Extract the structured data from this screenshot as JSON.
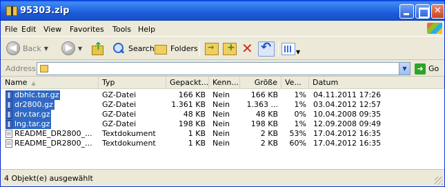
{
  "window": {
    "title": "95303.zip"
  },
  "menu": {
    "items": [
      "File",
      "Edit",
      "View",
      "Favorites",
      "Tools",
      "Help"
    ]
  },
  "toolbar": {
    "back_label": "Back",
    "search_label": "Search",
    "folders_label": "Folders"
  },
  "address": {
    "label": "Address",
    "value": "",
    "go_label": "Go"
  },
  "columns": [
    "Name",
    "Typ",
    "Gepackt...",
    "Kenn...",
    "Größe",
    "Ve...",
    "Datum"
  ],
  "files": [
    {
      "name": "dbhlc.tar.gz",
      "type": "GZ-Datei",
      "packed": "166 KB",
      "protected": "Nein",
      "size": "166 KB",
      "ratio": "1%",
      "date": "04.11.2011 17:26",
      "selected": true,
      "icon": "gz-archive-icon"
    },
    {
      "name": "dr2800.gz",
      "type": "GZ-Datei",
      "packed": "1.361 KB",
      "protected": "Nein",
      "size": "1.363 ...",
      "ratio": "1%",
      "date": "03.04.2012 12:57",
      "selected": true,
      "icon": "gz-archive-icon"
    },
    {
      "name": "drv.tar.gz",
      "type": "GZ-Datei",
      "packed": "48 KB",
      "protected": "Nein",
      "size": "48 KB",
      "ratio": "0%",
      "date": "10.04.2008 09:35",
      "selected": true,
      "icon": "gz-archive-icon"
    },
    {
      "name": "lng.tar.gz",
      "type": "GZ-Datei",
      "packed": "198 KB",
      "protected": "Nein",
      "size": "198 KB",
      "ratio": "1%",
      "date": "12.09.2008 09:49",
      "selected": true,
      "icon": "gz-archive-icon"
    },
    {
      "name": "README_DR2800_...",
      "type": "Textdokument",
      "packed": "1 KB",
      "protected": "Nein",
      "size": "2 KB",
      "ratio": "53%",
      "date": "17.04.2012 16:35",
      "selected": false,
      "icon": "text-document-icon"
    },
    {
      "name": "README_DR2800_...",
      "type": "Textdokument",
      "packed": "1 KB",
      "protected": "Nein",
      "size": "2 KB",
      "ratio": "60%",
      "date": "17.04.2012 16:35",
      "selected": false,
      "icon": "text-document-icon"
    }
  ],
  "status": {
    "text": "4 Objekt(e) ausgewählt"
  },
  "colors": {
    "titlebar": "#2a6fe8",
    "selection": "#316ac5",
    "chrome": "#ece9d8"
  }
}
